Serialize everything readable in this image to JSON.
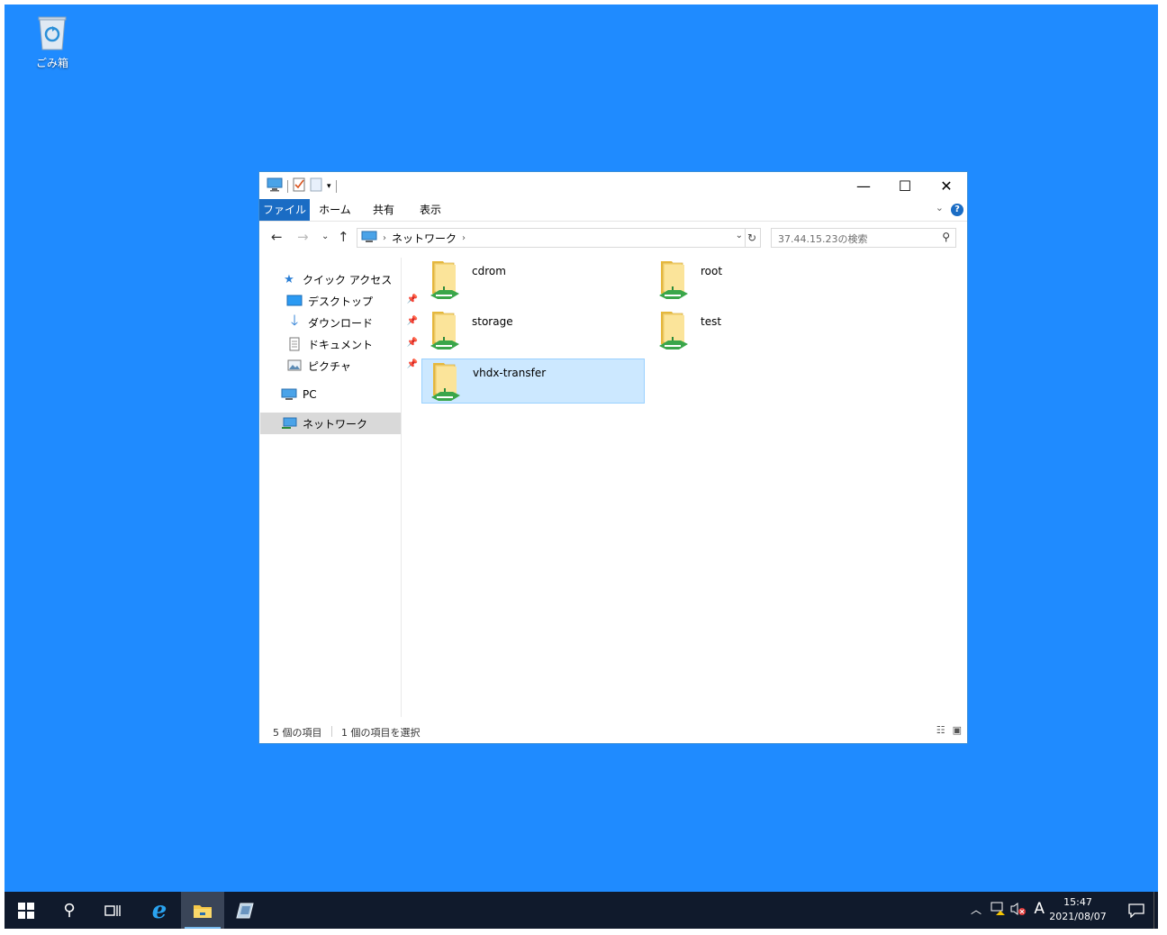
{
  "desktop": {
    "recycle_bin_label": "ごみ箱",
    "background_color": "#1f8bff"
  },
  "window": {
    "ribbon_tabs": [
      "ファイル",
      "ホーム",
      "共有",
      "表示"
    ],
    "help_label": "?",
    "address": {
      "location": "ネットワーク"
    },
    "search_placeholder": "37.44.15.23の検索",
    "sidebar": {
      "quick_access": "クイック アクセス",
      "desktop": "デスクトップ",
      "downloads": "ダウンロード",
      "documents": "ドキュメント",
      "pictures": "ピクチャ",
      "pc": "PC",
      "network": "ネットワーク"
    },
    "folders": [
      {
        "name": "cdrom",
        "selected": false
      },
      {
        "name": "root",
        "selected": false
      },
      {
        "name": "storage",
        "selected": false
      },
      {
        "name": "test",
        "selected": false
      },
      {
        "name": "vhdx-transfer",
        "selected": true
      }
    ],
    "status": {
      "count": "5 個の項目",
      "selected": "1 個の項目を選択"
    },
    "selection_color": "#cce8ff"
  },
  "taskbar": {
    "ime": "A",
    "time": "15:47",
    "date": "2021/08/07"
  }
}
